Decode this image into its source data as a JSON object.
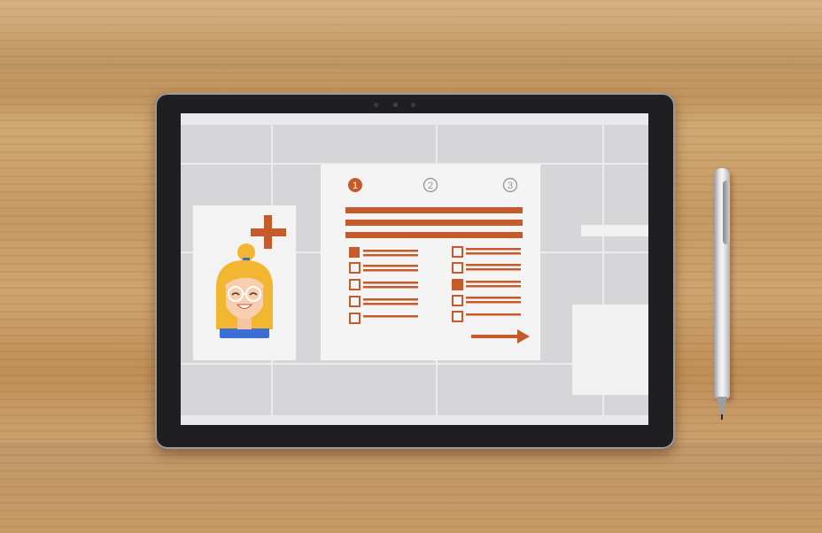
{
  "scene": {
    "subject": "tablet",
    "accent_color": "#c55a2a",
    "desk_color": "#c8995f"
  },
  "screen": {
    "background_color": "#d6d6d8",
    "card": {
      "avatar_icon": "woman-avatar-icon",
      "add_icon": "plus-icon"
    },
    "form": {
      "steps": [
        {
          "label": "1",
          "active": true
        },
        {
          "label": "2",
          "active": false
        },
        {
          "label": "3",
          "active": false
        }
      ],
      "left_checkboxes_checked": [
        true,
        false,
        false,
        false,
        false
      ],
      "right_checkboxes_checked": [
        false,
        false,
        true,
        false,
        false
      ],
      "next_icon": "arrow-right-icon"
    }
  },
  "accessory": {
    "pen": "stylus-pen"
  }
}
